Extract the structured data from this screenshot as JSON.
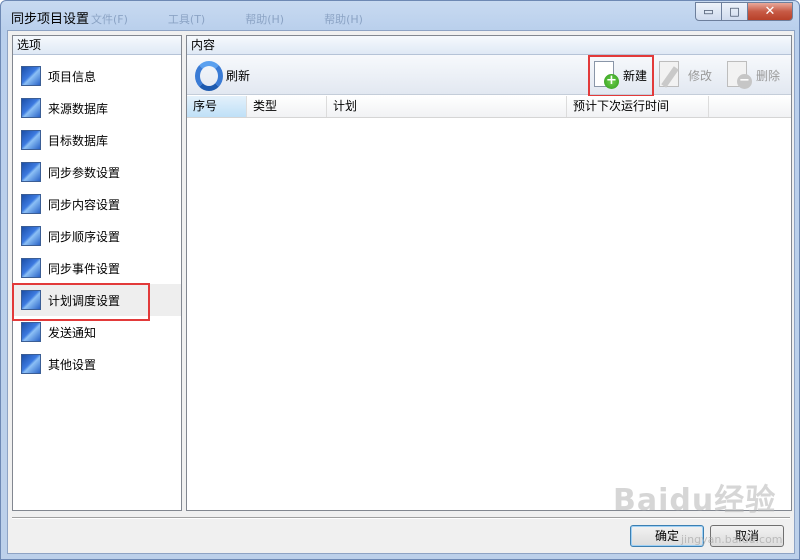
{
  "window": {
    "title": "同步项目设置",
    "controls": {
      "minimize": "▭",
      "maximize": "□",
      "close": "✕"
    }
  },
  "ghost_menu": [
    "文件(F)",
    "工具(T)",
    "帮助(H)",
    "帮助(H)"
  ],
  "options_panel": {
    "header": "选项",
    "items": [
      {
        "label": "项目信息",
        "icon": "blue-square-icon"
      },
      {
        "label": "来源数据库",
        "icon": "blue-square-icon"
      },
      {
        "label": "目标数据库",
        "icon": "blue-square-icon"
      },
      {
        "label": "同步参数设置",
        "icon": "blue-square-icon"
      },
      {
        "label": "同步内容设置",
        "icon": "blue-square-icon"
      },
      {
        "label": "同步顺序设置",
        "icon": "blue-square-icon"
      },
      {
        "label": "同步事件设置",
        "icon": "blue-square-icon"
      },
      {
        "label": "计划调度设置",
        "icon": "blue-square-icon",
        "selected": true
      },
      {
        "label": "发送通知",
        "icon": "blue-square-icon"
      },
      {
        "label": "其他设置",
        "icon": "blue-square-icon"
      }
    ]
  },
  "content_panel": {
    "header": "内容",
    "toolbar": {
      "refresh": "刷新",
      "new": "新建",
      "edit": "修改",
      "delete": "删除"
    },
    "columns": [
      "序号",
      "类型",
      "计划",
      "预计下次运行时间"
    ]
  },
  "buttons": {
    "ok": "确定",
    "cancel": "取消"
  },
  "watermark": {
    "brand": "Baidu经验",
    "url": "jingyan.baidu.com"
  },
  "colors": {
    "highlight": "#e23a3a",
    "accent": "#3a7bd5"
  }
}
